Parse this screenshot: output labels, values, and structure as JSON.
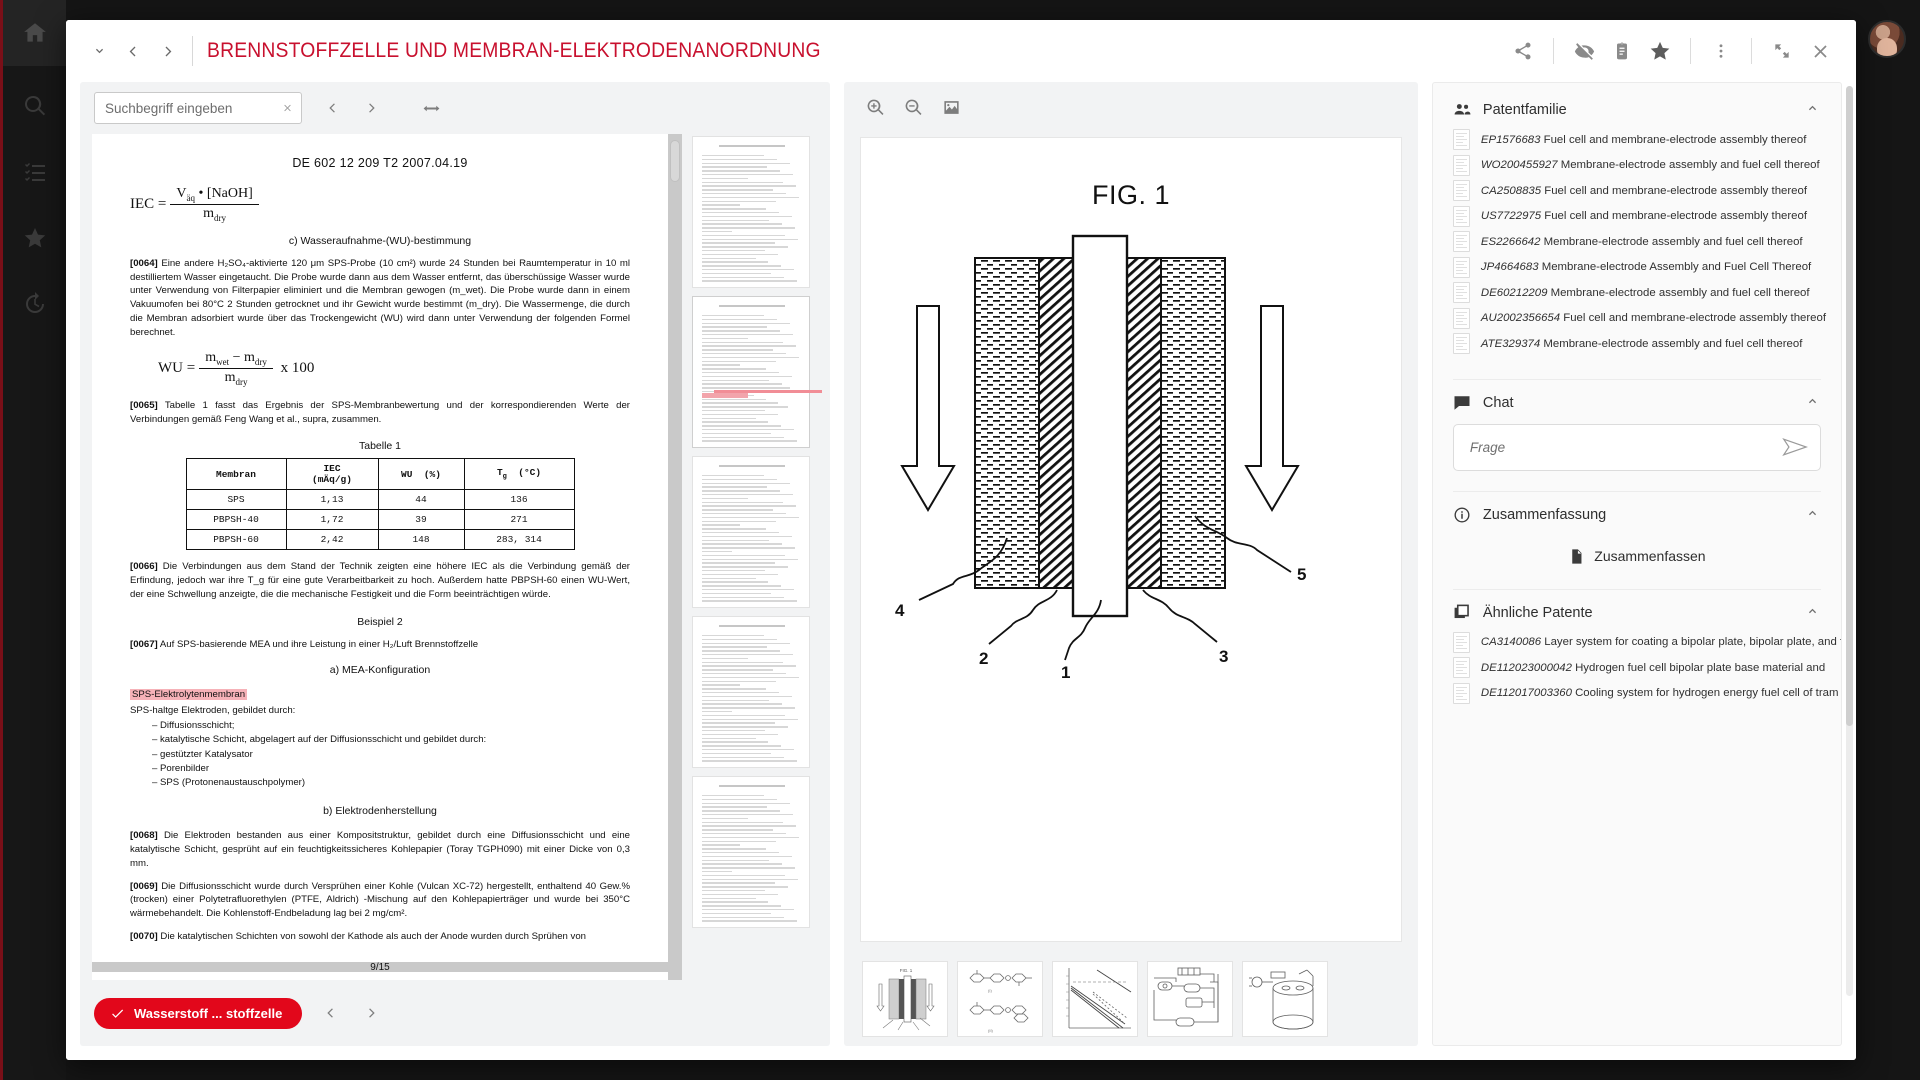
{
  "app": {
    "rail": [
      {
        "name": "home-icon",
        "label": "Home"
      },
      {
        "name": "search-icon",
        "label": "Suche"
      },
      {
        "name": "checklist-icon",
        "label": "Listen"
      },
      {
        "name": "star-icon",
        "label": "Favoriten"
      },
      {
        "name": "history-icon",
        "label": "Verlauf"
      }
    ],
    "accent_color": "#c8102e",
    "chip_color": "#e2071b"
  },
  "header": {
    "title": "BRENNSTOFFZELLE UND MEMBRAN-ELEKTRODENANORDNUNG",
    "nav": {
      "dropdown_icon": "chevron-down-icon",
      "prev_icon": "chevron-left-icon",
      "next_icon": "chevron-right-icon"
    },
    "actions": [
      {
        "name": "share-icon",
        "label": "Teilen"
      },
      {
        "name": "eye-off-icon",
        "label": "Ausblenden"
      },
      {
        "name": "clipboard-icon",
        "label": "Notizen"
      },
      {
        "name": "star-icon",
        "label": "Favorit"
      },
      {
        "name": "more-options-icon",
        "label": "Weitere Optionen"
      },
      {
        "name": "fullscreen-icon",
        "label": "Vollbild"
      },
      {
        "name": "close-icon",
        "label": "Schließen"
      }
    ]
  },
  "document_panel": {
    "search": {
      "placeholder": "Suchbegriff eingeben",
      "value": "",
      "clear_icon": "close-icon",
      "prev_icon": "chevron-left-icon",
      "next_icon": "chevron-right-icon",
      "fit_width_icon": "fit-width-icon"
    },
    "page": {
      "header": "DE 602 12 209 T2    2007.04.19",
      "formula_iec_lhs": "IEC =",
      "formula_iec_num": "V",
      "formula_iec_num_sub": "äq",
      "formula_iec_num_rest": "• [NaOH]",
      "formula_iec_den": "m",
      "formula_iec_den_sub": "dry",
      "section_c": "c) Wasseraufnahme-(WU)-bestimmung",
      "p0064_num": "[0064]",
      "p0064": "Eine andere H₂SO₄-aktivierte 120 μm SPS-Probe (10 cm²) wurde 24 Stunden bei Raumtemperatur in 10 ml destilliertem Wasser eingetaucht. Die Probe wurde dann aus dem Wasser entfernt, das überschüssige Wasser wurde unter Verwendung von Filterpapier eliminiert und die Membran gewogen (m_wet). Die Probe wurde dann in einem Vakuumofen bei 80°C 2 Stunden getrocknet und ihr Gewicht wurde bestimmt (m_dry). Die Wassermenge, die durch die Membran adsorbiert wurde über das Trockengewicht (WU) wird dann unter Verwendung der folgenden Formel berechnet.",
      "formula_wu_lhs": "WU =",
      "formula_wu_num": "m",
      "formula_wu_num_sub": "wet",
      "formula_wu_num_mid": "−  m",
      "formula_wu_num_sub2": "dry",
      "formula_wu_den": "m",
      "formula_wu_den_sub": "dry",
      "formula_wu_tail": "x 100",
      "p0065_num": "[0065]",
      "p0065": "Tabelle 1 fasst das Ergebnis der SPS-Membranbewertung und der korrespondierenden Werte der Verbindungen gemäß Feng Wang et al., supra, zusammen.",
      "table_caption": "Tabelle 1",
      "table": {
        "headers": [
          "Membran",
          "IEC (mÄq/g)",
          "WU (%)",
          "T_g (°C)"
        ],
        "header_lines": [
          [
            "Membran",
            ""
          ],
          [
            "IEC",
            "(mÄq/g)"
          ],
          [
            "WU  (%)",
            ""
          ],
          [
            "Tg  (°C)",
            ""
          ]
        ],
        "rows": [
          [
            "SPS",
            "1,13",
            "44",
            "136"
          ],
          [
            "PBPSH-40",
            "1,72",
            "39",
            "271"
          ],
          [
            "PBPSH-60",
            "2,42",
            "148",
            "283, 314"
          ]
        ]
      },
      "p0066_num": "[0066]",
      "p0066": "Die Verbindungen aus dem Stand der Technik zeigten eine höhere IEC als die Verbindung gemäß der Erfindung, jedoch war ihre T_g für eine gute Verarbeitbarkeit zu hoch. Außerdem hatte PBPSH-60 einen WU-Wert, der eine Schwellung anzeigte, die die mechanische Festigkeit und die Form beeinträchtigen würde.",
      "beispiel2": "Beispiel 2",
      "p0067_num": "[0067]",
      "p0067": "Auf SPS-basierende MEA und ihre Leistung in einer H₂/Luft Brennstoffzelle",
      "section_a": "a) MEA-Konfiguration",
      "highlight": "SPS-Elektrolytenmembran",
      "list_intro": "SPS-haltge Elektroden, gebildet durch:",
      "list_items": [
        "– Diffusionsschicht;",
        "– katalytische Schicht, abgelagert auf der Diffusionsschicht und gebildet durch:",
        "– gestützter Katalysator",
        "– Porenbilder",
        "– SPS (Protonenaustauschpolymer)"
      ],
      "section_b": "b) Elektrodenherstellung",
      "p0068_num": "[0068]",
      "p0068": "Die Elektroden bestanden aus einer Kompositstruktur, gebildet durch eine Diffusionsschicht und eine katalytische Schicht, gesprüht auf ein feuchtigkeitssicheres Kohlepapier (Toray TGPH090) mit einer Dicke von 0,3 mm.",
      "p0069_num": "[0069]",
      "p0069": "Die Diffusionsschicht wurde durch Versprühen einer Kohle (Vulcan XC-72) hergestellt, enthaltend 40 Gew.% (trocken) einer Polytetrafluorethylen (PTFE, Aldrich) -Mischung auf den Kohlepapierträger und wurde bei 350°C wärmebehandelt. Die Kohlenstoff-Endbeladung lag bei 2 mg/cm².",
      "p0070_num": "[0070]",
      "p0070": "Die katalytischen Schichten von sowohl der Kathode als auch der Anode wurden durch Sprühen von",
      "page_number": "9/15"
    },
    "bottom": {
      "term_chip": "Wasserstoff ... stoffzelle",
      "check_icon": "check-icon",
      "prev_icon": "chevron-left-icon",
      "next_icon": "chevron-right-icon"
    }
  },
  "image_panel": {
    "toolbar": [
      {
        "name": "zoom-in-icon",
        "label": "Vergrößern"
      },
      {
        "name": "zoom-out-icon",
        "label": "Verkleinern"
      },
      {
        "name": "image-icon",
        "label": "Bild"
      }
    ],
    "figure_label": "FIG. 1",
    "figure_callouts": [
      "1",
      "2",
      "3",
      "4",
      "5"
    ],
    "thumbnails": [
      {
        "name": "figure-thumb-1",
        "label": "FIG. 1"
      },
      {
        "name": "figure-thumb-2",
        "label": "FIG. 2"
      },
      {
        "name": "figure-thumb-3",
        "label": "FIG. 3"
      },
      {
        "name": "figure-thumb-4",
        "label": "FIG. 4"
      },
      {
        "name": "figure-thumb-5",
        "label": "FIG. 5"
      }
    ]
  },
  "right_panel": {
    "patent_family": {
      "icon": "people-icon",
      "title": "Patentfamilie",
      "collapse_icon": "chevron-up-icon",
      "items": [
        {
          "id": "EP1576683",
          "title": "Fuel cell and membrane-electrode assembly thereof"
        },
        {
          "id": "WO200455927",
          "title": "Membrane-electrode assembly and fuel cell thereof"
        },
        {
          "id": "CA2508835",
          "title": "Fuel cell and membrane-electrode assembly thereof"
        },
        {
          "id": "US7722975",
          "title": "Fuel cell and membrane-electrode assembly thereof"
        },
        {
          "id": "ES2266642",
          "title": "Membrane-electrode assembly and fuel cell thereof"
        },
        {
          "id": "JP4664683",
          "title": "Membrane-electrode Assembly and Fuel Cell Thereof"
        },
        {
          "id": "DE60212209",
          "title": "Membrane-electrode assembly and fuel cell thereof"
        },
        {
          "id": "AU2002356654",
          "title": "Fuel cell and membrane-electrode assembly thereof"
        },
        {
          "id": "ATE329374",
          "title": "Membrane-electrode assembly and fuel cell thereof"
        }
      ]
    },
    "chat": {
      "icon": "chat-icon",
      "title": "Chat",
      "collapse_icon": "chevron-up-icon",
      "placeholder": "Frage",
      "value": "",
      "send_icon": "send-icon"
    },
    "summary": {
      "icon": "info-icon",
      "title": "Zusammenfassung",
      "collapse_icon": "chevron-up-icon",
      "button_icon": "document-icon",
      "button_label": "Zusammenfassen"
    },
    "similar_patents": {
      "icon": "books-icon",
      "title": "Ähnliche Patente",
      "collapse_icon": "chevron-up-icon",
      "items": [
        {
          "id": "CA3140086",
          "title": "Layer system for coating a bipolar plate, bipolar plate, and fuel"
        },
        {
          "id": "DE112023000042",
          "title": "Hydrogen fuel cell bipolar plate base material and"
        },
        {
          "id": "DE112017003360",
          "title": "Cooling system for hydrogen energy fuel cell of tram"
        }
      ]
    }
  }
}
